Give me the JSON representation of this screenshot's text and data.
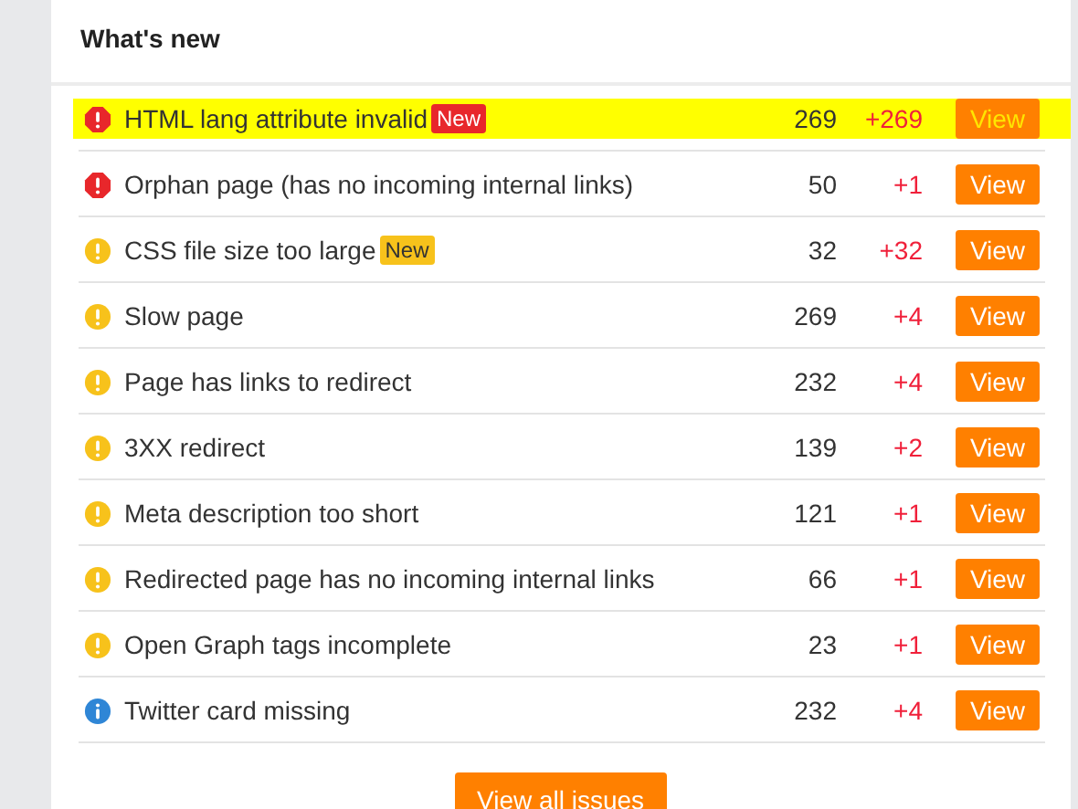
{
  "panel": {
    "title": "What's new"
  },
  "issues": [
    {
      "kind": "error",
      "title": "HTML lang attribute invalid",
      "badge": "New",
      "count": "269",
      "change": "+269",
      "action": "View",
      "highlighted": true
    },
    {
      "kind": "error",
      "title": "Orphan page (has no incoming internal links)",
      "count": "50",
      "change": "+1",
      "action": "View",
      "highlighted": false
    },
    {
      "kind": "warning",
      "title": "CSS file size too large",
      "badge": "New",
      "count": "32",
      "change": "+32",
      "action": "View",
      "highlighted": false
    },
    {
      "kind": "warning",
      "title": "Slow page",
      "count": "269",
      "change": "+4",
      "action": "View",
      "highlighted": false
    },
    {
      "kind": "warning",
      "title": "Page has links to redirect",
      "count": "232",
      "change": "+4",
      "action": "View",
      "highlighted": false
    },
    {
      "kind": "warning",
      "title": "3XX redirect",
      "count": "139",
      "change": "+2",
      "action": "View",
      "highlighted": false
    },
    {
      "kind": "warning",
      "title": "Meta description too short",
      "count": "121",
      "change": "+1",
      "action": "View",
      "highlighted": false
    },
    {
      "kind": "warning",
      "title": "Redirected page has no incoming internal links",
      "count": "66",
      "change": "+1",
      "action": "View",
      "highlighted": false
    },
    {
      "kind": "warning",
      "title": "Open Graph tags incomplete",
      "count": "23",
      "change": "+1",
      "action": "View",
      "highlighted": false
    },
    {
      "kind": "notice",
      "title": "Twitter card missing",
      "count": "232",
      "change": "+4",
      "action": "View",
      "highlighted": false
    }
  ],
  "footer": {
    "button": "View all issues"
  }
}
